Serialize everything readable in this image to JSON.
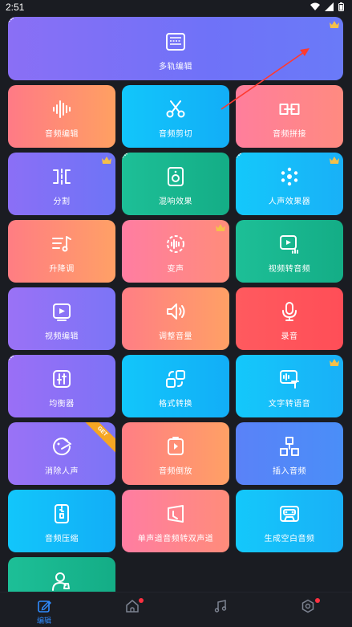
{
  "status_bar": {
    "time": "2:51"
  },
  "banner": {
    "label": "多轨编辑",
    "badge": "NEW",
    "premium": true
  },
  "tiles": [
    {
      "label": "音频编辑",
      "icon": "waveform-icon",
      "gradient": [
        "#ff7a86",
        "#ffa062"
      ],
      "badge": "",
      "premium": false
    },
    {
      "label": "音频剪切",
      "icon": "scissors-icon",
      "gradient": [
        "#12c6fb",
        "#12aef7"
      ],
      "badge": "",
      "premium": false
    },
    {
      "label": "音频拼接",
      "icon": "join-icon",
      "gradient": [
        "#ff7e9c",
        "#ff8a80"
      ],
      "badge": "",
      "premium": false
    },
    {
      "label": "分割",
      "icon": "split-icon",
      "gradient": [
        "#8b6ff6",
        "#6e74f6"
      ],
      "badge": "",
      "premium": true
    },
    {
      "label": "混响效果",
      "icon": "speaker-icon",
      "gradient": [
        "#1dbf97",
        "#14ad86"
      ],
      "badge": "NEW",
      "premium": false
    },
    {
      "label": "人声效果器",
      "icon": "dots-flower-icon",
      "gradient": [
        "#14c8fb",
        "#19b0f7"
      ],
      "badge": "NEW",
      "premium": true
    },
    {
      "label": "升降调",
      "icon": "pitch-icon",
      "gradient": [
        "#ff7d83",
        "#ffa066"
      ],
      "badge": "",
      "premium": false
    },
    {
      "label": "变声",
      "icon": "voice-change-icon",
      "gradient": [
        "#ff7da2",
        "#ff8c7a"
      ],
      "badge": "",
      "premium": true
    },
    {
      "label": "视频转音频",
      "icon": "video-to-audio-icon",
      "gradient": [
        "#1dbf97",
        "#14ad86"
      ],
      "badge": "",
      "premium": false
    },
    {
      "label": "视频编辑",
      "icon": "video-play-icon",
      "gradient": [
        "#9a72f6",
        "#7c74f6"
      ],
      "badge": "",
      "premium": false
    },
    {
      "label": "调整音量",
      "icon": "volume-icon",
      "gradient": [
        "#ff7e85",
        "#ffa065"
      ],
      "badge": "",
      "premium": false
    },
    {
      "label": "录音",
      "icon": "microphone-icon",
      "gradient": [
        "#ff5a5f",
        "#ff4e57"
      ],
      "badge": "",
      "premium": false
    },
    {
      "label": "均衡器",
      "icon": "equalizer-icon",
      "gradient": [
        "#9a6ff6",
        "#7e72f6"
      ],
      "badge": "NEW",
      "premium": false
    },
    {
      "label": "格式转换",
      "icon": "convert-icon",
      "gradient": [
        "#12c6fb",
        "#12aef7"
      ],
      "badge": "",
      "premium": false
    },
    {
      "label": "文字转语音",
      "icon": "text-to-speech-icon",
      "gradient": [
        "#14c8fb",
        "#19b0f7"
      ],
      "badge": "",
      "premium": true
    },
    {
      "label": "消除人声",
      "icon": "remove-vocal-icon",
      "gradient": [
        "#9a72f6",
        "#7c74f6"
      ],
      "badge": "",
      "premium": false,
      "ribbon": "GET"
    },
    {
      "label": "音频倒放",
      "icon": "reverse-icon",
      "gradient": [
        "#ff7e85",
        "#ffa065"
      ],
      "badge": "",
      "premium": false
    },
    {
      "label": "插入音频",
      "icon": "insert-icon",
      "gradient": [
        "#5a82f8",
        "#4a8ef8"
      ],
      "badge": "",
      "premium": false
    },
    {
      "label": "音频压缩",
      "icon": "zip-icon",
      "gradient": [
        "#12c6fb",
        "#12aef7"
      ],
      "badge": "",
      "premium": false
    },
    {
      "label": "单声道音频转双声道",
      "icon": "mono-stereo-icon",
      "gradient": [
        "#ff7da2",
        "#ff8c7a"
      ],
      "badge": "",
      "premium": false
    },
    {
      "label": "生成空白音频",
      "icon": "cassette-icon",
      "gradient": [
        "#14c8fb",
        "#19b0f7"
      ],
      "badge": "",
      "premium": false
    },
    {
      "label": "",
      "icon": "user-icon",
      "gradient": [
        "#1dbf97",
        "#14ad86"
      ],
      "badge": "",
      "premium": false
    }
  ],
  "bottom_nav": [
    {
      "label": "编辑",
      "icon": "edit-icon",
      "active": true,
      "dot": false
    },
    {
      "label": "",
      "icon": "home-icon",
      "active": false,
      "dot": true
    },
    {
      "label": "",
      "icon": "music-note-icon",
      "active": false,
      "dot": false
    },
    {
      "label": "",
      "icon": "settings-icon",
      "active": false,
      "dot": true
    }
  ],
  "colors": {
    "background": "#1a1c22",
    "accent": "#2f8bff",
    "crown": "#f5c04a",
    "notification": "#ff3040"
  }
}
